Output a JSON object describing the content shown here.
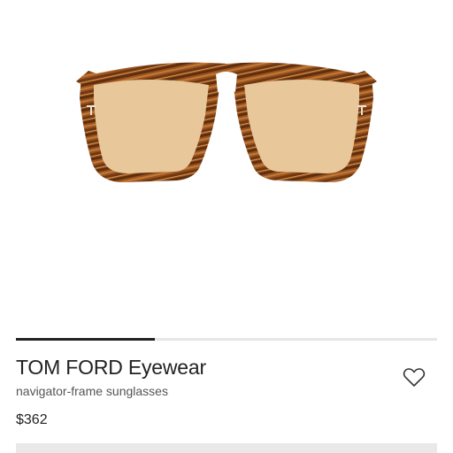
{
  "product": {
    "brand": "TOM FORD Eyewear",
    "description": "navigator-frame sunglasses",
    "price": "$362"
  },
  "gallery": {
    "progress_fraction": 0.33
  },
  "icons": {
    "wishlist": "heart-outline-icon"
  },
  "colors": {
    "text": "#222222",
    "subtext": "#555555",
    "tortoise_frame": "#8a4a1c",
    "lens_tint": "#e8c79a"
  }
}
